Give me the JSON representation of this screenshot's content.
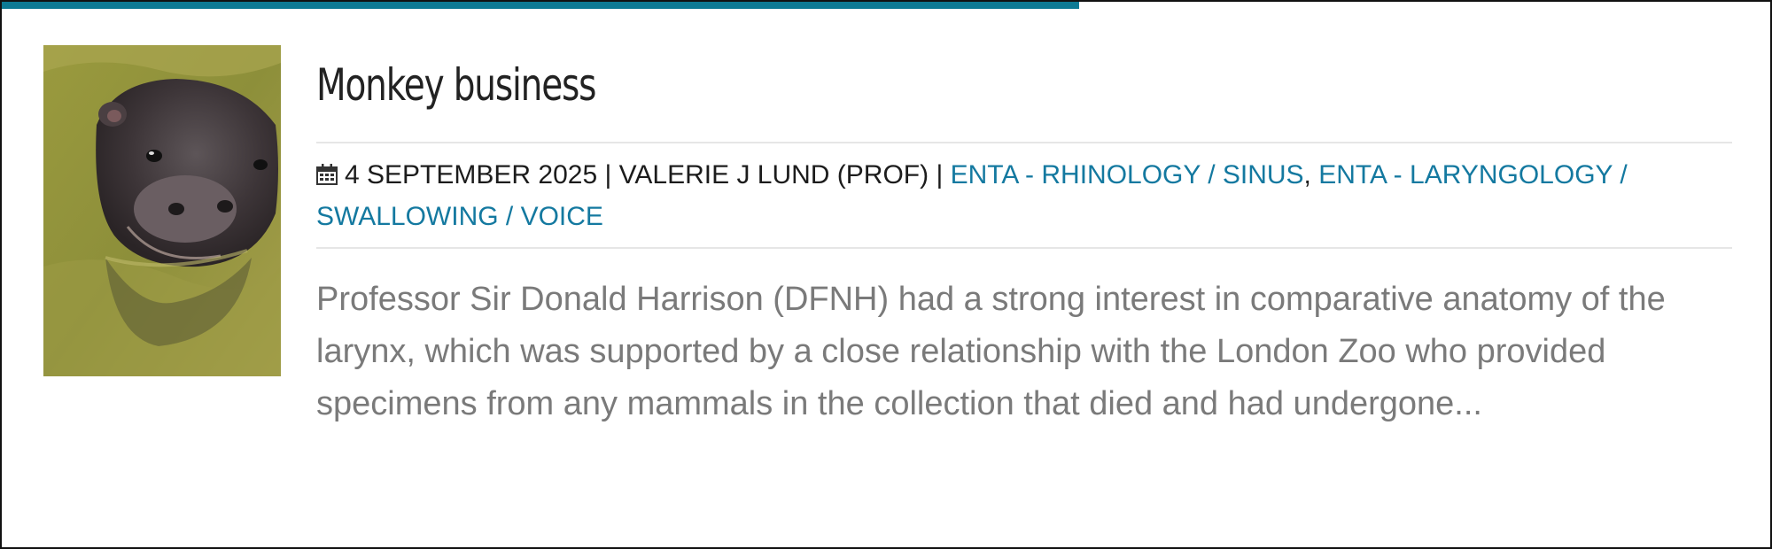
{
  "post": {
    "title": "Monkey business",
    "date": "4 September 2025",
    "separator": " | ",
    "author": "Valerie J Lund (Prof)",
    "category_comma": ", ",
    "categories": [
      "ENTA - Rhinology / Sinus",
      "ENTA - Laryngology / Swallowing / Voice"
    ],
    "excerpt": "Professor Sir Donald Harrison (DFNH) had a strong interest in comparative anatomy of the larynx, which was supported by a close relationship with the London Zoo who provided specimens from any mammals in the collection that died and had undergone...",
    "thumbnail_icon": "pygmy-hippo-photo",
    "date_icon": "calendar-icon"
  },
  "colors": {
    "accent": "#0d7a94",
    "link": "#1479a0",
    "title": "#222222",
    "excerpt": "#7a7a7a",
    "meta": "#1c1c1c"
  }
}
